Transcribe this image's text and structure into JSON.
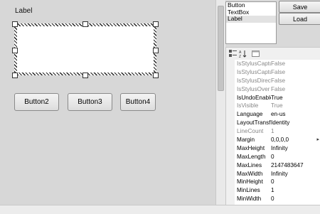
{
  "designer": {
    "label": "Label",
    "buttons": [
      "Button2",
      "Button3",
      "Button4"
    ]
  },
  "toolbox": {
    "items": [
      "Button",
      "TextBox",
      "Label"
    ],
    "selected": "Label"
  },
  "actions": {
    "save": "Save",
    "load": "Load"
  },
  "properties": [
    {
      "name": "IsStylusCaptu",
      "value": "False",
      "disabled": true
    },
    {
      "name": "IsStylusCaptu",
      "value": "False",
      "disabled": true
    },
    {
      "name": "IsStylusDirect",
      "value": "False",
      "disabled": true
    },
    {
      "name": "IsStylusOver",
      "value": "False",
      "disabled": true
    },
    {
      "name": "IsUndoEnable",
      "value": "True",
      "disabled": false
    },
    {
      "name": "IsVisible",
      "value": "True",
      "disabled": true
    },
    {
      "name": "Language",
      "value": "en-us",
      "disabled": false
    },
    {
      "name": "LayoutTransf",
      "value": "Identity",
      "disabled": false
    },
    {
      "name": "LineCount",
      "value": "1",
      "disabled": true
    },
    {
      "name": "Margin",
      "value": "0,0,0,0",
      "disabled": false,
      "arrow": true
    },
    {
      "name": "MaxHeight",
      "value": "Infinity",
      "disabled": false
    },
    {
      "name": "MaxLength",
      "value": "0",
      "disabled": false
    },
    {
      "name": "MaxLines",
      "value": "2147483647",
      "disabled": false
    },
    {
      "name": "MaxWidth",
      "value": "Infinity",
      "disabled": false
    },
    {
      "name": "MinHeight",
      "value": "0",
      "disabled": false
    },
    {
      "name": "MinLines",
      "value": "1",
      "disabled": false
    },
    {
      "name": "MinWidth",
      "value": "0",
      "disabled": false
    }
  ]
}
